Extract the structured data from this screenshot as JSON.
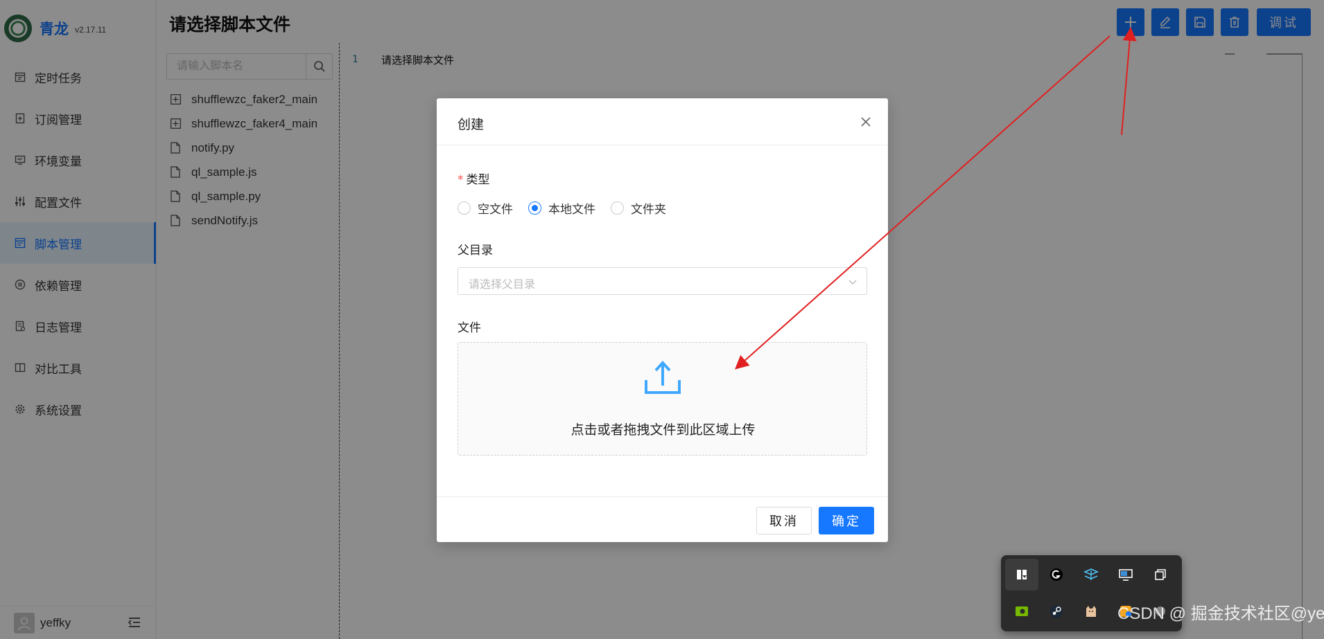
{
  "app": {
    "name": "青龙",
    "version": "v2.17.11"
  },
  "sidebar": {
    "items": [
      {
        "label": "定时任务",
        "icon": "calendar-icon"
      },
      {
        "label": "订阅管理",
        "icon": "subscription-icon"
      },
      {
        "label": "环境变量",
        "icon": "monitor-icon"
      },
      {
        "label": "配置文件",
        "icon": "sliders-icon"
      },
      {
        "label": "脚本管理",
        "icon": "script-icon",
        "active": true
      },
      {
        "label": "依赖管理",
        "icon": "dependency-icon"
      },
      {
        "label": "日志管理",
        "icon": "log-icon"
      },
      {
        "label": "对比工具",
        "icon": "diff-icon"
      },
      {
        "label": "系统设置",
        "icon": "gear-icon"
      }
    ],
    "user": {
      "name": "yeffky"
    }
  },
  "header": {
    "title": "请选择脚本文件",
    "debug_label": "调试",
    "tools": [
      "plus-icon",
      "edit-icon",
      "save-icon",
      "delete-icon"
    ]
  },
  "tree": {
    "search_placeholder": "请输入脚本名",
    "items": [
      {
        "name": "shufflewzc_faker2_main",
        "type": "folder"
      },
      {
        "name": "shufflewzc_faker4_main",
        "type": "folder"
      },
      {
        "name": "notify.py",
        "type": "file"
      },
      {
        "name": "ql_sample.js",
        "type": "file"
      },
      {
        "name": "ql_sample.py",
        "type": "file"
      },
      {
        "name": "sendNotify.js",
        "type": "file"
      }
    ]
  },
  "editor": {
    "line_number": "1",
    "line_text": "请选择脚本文件"
  },
  "modal": {
    "title": "创建",
    "type_label": "类型",
    "required_mark": "*",
    "options": [
      {
        "label": "空文件",
        "checked": false
      },
      {
        "label": "本地文件",
        "checked": true
      },
      {
        "label": "文件夹",
        "checked": false
      }
    ],
    "parent_label": "父目录",
    "parent_placeholder": "请选择父目录",
    "file_label": "文件",
    "upload_text": "点击或者拖拽文件到此区域上传",
    "cancel_label": "取消",
    "ok_label": "确定"
  },
  "tray": {
    "icons": [
      "bookmark-icon",
      "logitech-icon",
      "network-icon",
      "display-icon",
      "copy-icon",
      "nvidia-icon",
      "steam-icon",
      "cat-icon",
      "app-icon",
      "app2-icon"
    ]
  },
  "watermark": "CSDN @ 掘金技术社区@yeffky亦",
  "colors": {
    "accent": "#1677ff",
    "annotation": "#e02020"
  }
}
